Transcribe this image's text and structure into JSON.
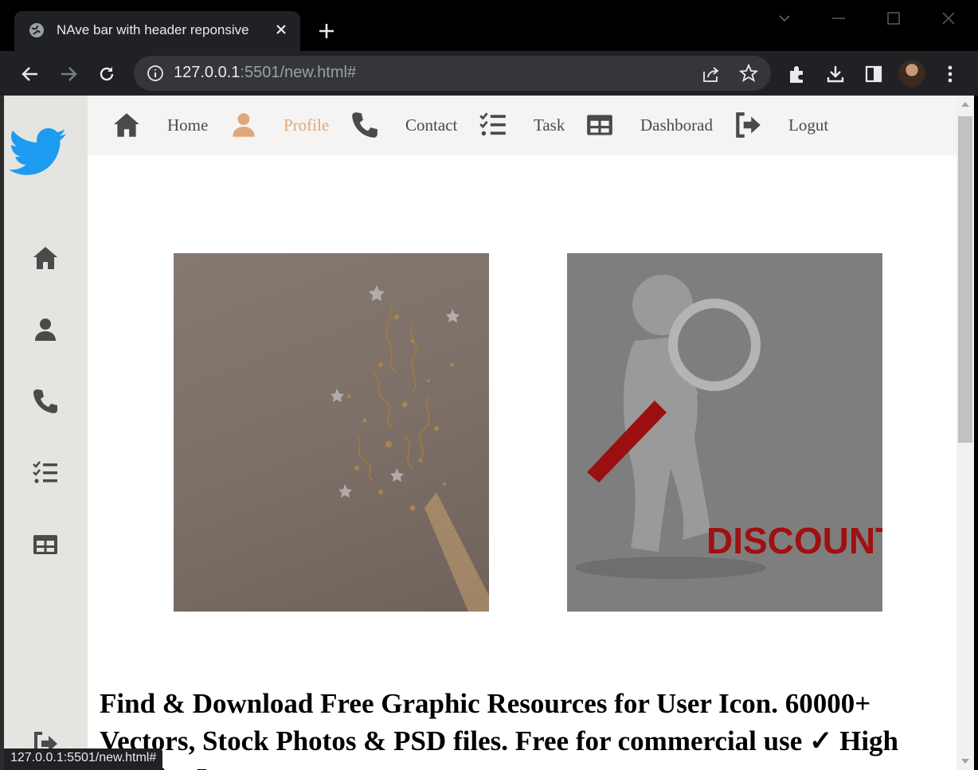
{
  "browser": {
    "tab_title": "NAve bar with header reponsive",
    "url_host": "127.0.0.1",
    "url_rest": ":5501/new.html#",
    "status_url": "127.0.0.1:5501/new.html#"
  },
  "nav": {
    "items": [
      {
        "label": "Home",
        "icon": "home-icon",
        "active": false
      },
      {
        "label": "Profile",
        "icon": "user-icon",
        "active": true
      },
      {
        "label": "Contact",
        "icon": "phone-icon",
        "active": false
      },
      {
        "label": "Task",
        "icon": "tasks-icon",
        "active": false
      },
      {
        "label": "Dashborad",
        "icon": "table-icon",
        "active": false
      },
      {
        "label": "Logut",
        "icon": "logout-icon",
        "active": false
      }
    ],
    "active_color": "#e0a77a"
  },
  "sidebar": {
    "logo": "twitter-logo",
    "icons": [
      "home-icon",
      "user-icon",
      "phone-icon",
      "tasks-icon",
      "table-icon",
      "logout-icon"
    ]
  },
  "images": {
    "second_image_text": "DISCOUNT"
  },
  "content": {
    "headline": "Find & Download Free Graphic Resources for User Icon. 60000+ Vectors, Stock Photos & PSD files. Free for commercial use ✓ High Quality Images"
  }
}
